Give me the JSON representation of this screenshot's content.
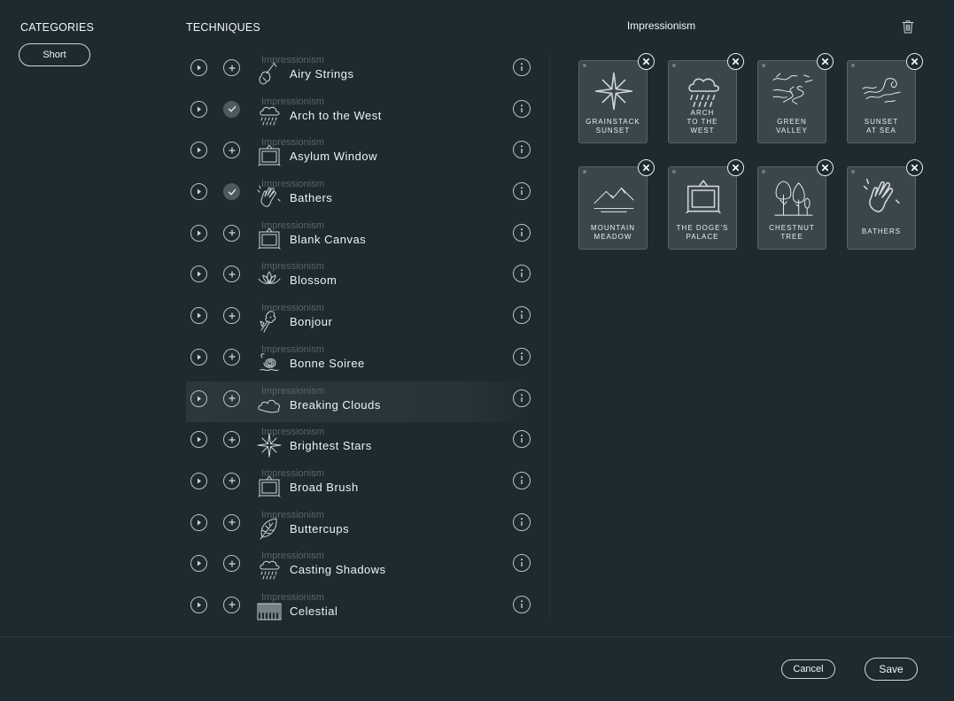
{
  "categories": {
    "title": "CATEGORIES",
    "pills": [
      "Short"
    ]
  },
  "techniques": {
    "title": "TECHNIQUES",
    "items": [
      {
        "category": "Impressionism",
        "name": "Airy Strings",
        "icon": "violin-icon",
        "added": false
      },
      {
        "category": "Impressionism",
        "name": "Arch to the West",
        "icon": "rain-cloud-icon",
        "added": true
      },
      {
        "category": "Impressionism",
        "name": "Asylum Window",
        "icon": "picture-frame-icon",
        "added": false
      },
      {
        "category": "Impressionism",
        "name": "Bathers",
        "icon": "waving-hand-icon",
        "added": true
      },
      {
        "category": "Impressionism",
        "name": "Blank Canvas",
        "icon": "picture-frame-icon",
        "added": false
      },
      {
        "category": "Impressionism",
        "name": "Blossom",
        "icon": "lotus-icon",
        "added": false
      },
      {
        "category": "Impressionism",
        "name": "Bonjour",
        "icon": "flower-bouquet-icon",
        "added": false
      },
      {
        "category": "Impressionism",
        "name": "Bonne Soiree",
        "icon": "swirl-icon",
        "added": false
      },
      {
        "category": "Impressionism",
        "name": "Breaking Clouds",
        "icon": "cloud-icon",
        "added": false,
        "hover": true
      },
      {
        "category": "Impressionism",
        "name": "Brightest Stars",
        "icon": "star-icon",
        "added": false
      },
      {
        "category": "Impressionism",
        "name": "Broad Brush",
        "icon": "picture-frame-icon",
        "added": false
      },
      {
        "category": "Impressionism",
        "name": "Buttercups",
        "icon": "leaf-icon",
        "added": false
      },
      {
        "category": "Impressionism",
        "name": "Casting Shadows",
        "icon": "rain-cloud-icon",
        "added": false
      },
      {
        "category": "Impressionism",
        "name": "Celestial",
        "icon": "piano-keys-icon",
        "added": false
      }
    ]
  },
  "selection": {
    "title": "Impressionism",
    "cards": [
      {
        "label": "GRAINSTACK\nSUNSET",
        "icon": "star-icon"
      },
      {
        "label": "ARCH\nTO THE\nWEST",
        "icon": "rain-cloud-icon"
      },
      {
        "label": "GREEN\nVALLEY",
        "icon": "river-valley-icon"
      },
      {
        "label": "SUNSET\nAT SEA",
        "icon": "wave-icon"
      },
      {
        "label": "MOUNTAIN\nMEADOW",
        "icon": "mountains-icon"
      },
      {
        "label": "THE DOGE'S\nPALACE",
        "icon": "picture-frame-icon"
      },
      {
        "label": "CHESTNUT\nTREE",
        "icon": "trees-icon"
      },
      {
        "label": "BATHERS",
        "icon": "waving-hand-icon"
      }
    ]
  },
  "footer": {
    "cancel": "Cancel",
    "save": "Save"
  }
}
